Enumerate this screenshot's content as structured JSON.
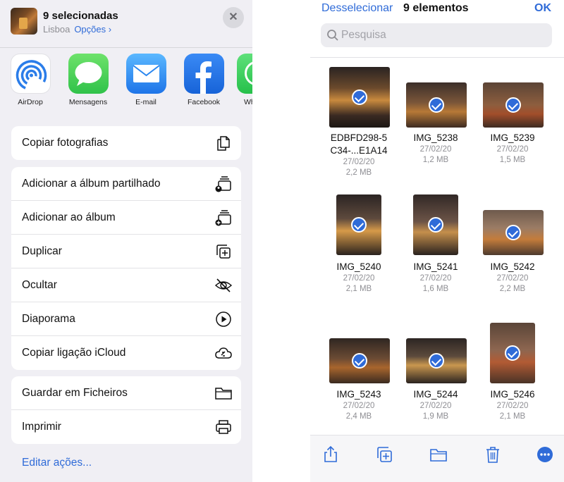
{
  "share_sheet": {
    "title": "9 selecionadas",
    "location": "Lisboa",
    "options_label": "Opções ›",
    "apps": [
      {
        "label": "AirDrop",
        "icon": "airdrop-icon"
      },
      {
        "label": "Mensagens",
        "icon": "messages-icon"
      },
      {
        "label": "E-mail",
        "icon": "mail-icon"
      },
      {
        "label": "Facebook",
        "icon": "facebook-icon"
      },
      {
        "label": "Wh",
        "icon": "whatsapp-icon"
      }
    ],
    "group1": [
      {
        "label": "Copiar fotografias",
        "icon": "copy-icon"
      }
    ],
    "group2": [
      {
        "label": "Adicionar a álbum partilhado",
        "icon": "shared-album-icon"
      },
      {
        "label": "Adicionar ao álbum",
        "icon": "add-album-icon"
      },
      {
        "label": "Duplicar",
        "icon": "duplicate-icon"
      },
      {
        "label": "Ocultar",
        "icon": "hide-icon"
      },
      {
        "label": "Diaporama",
        "icon": "play-icon"
      },
      {
        "label": "Copiar ligação iCloud",
        "icon": "icloud-link-icon"
      }
    ],
    "group3": [
      {
        "label": "Guardar em Ficheiros",
        "icon": "folder-icon"
      },
      {
        "label": "Imprimir",
        "icon": "printer-icon"
      }
    ],
    "edit_actions": "Editar ações..."
  },
  "files": {
    "deselect": "Desselecionar",
    "title": "9 elementos",
    "ok": "OK",
    "search_placeholder": "Pesquisa",
    "items": [
      {
        "name1": "EDBFD298-5",
        "name2": "C34-...E1A14",
        "date": "27/02/20",
        "size": "2,2 MB"
      },
      {
        "name1": "IMG_5238",
        "name2": "",
        "date": "27/02/20",
        "size": "1,2 MB"
      },
      {
        "name1": "IMG_5239",
        "name2": "",
        "date": "27/02/20",
        "size": "1,5 MB"
      },
      {
        "name1": "IMG_5240",
        "name2": "",
        "date": "27/02/20",
        "size": "2,1 MB"
      },
      {
        "name1": "IMG_5241",
        "name2": "",
        "date": "27/02/20",
        "size": "1,6 MB"
      },
      {
        "name1": "IMG_5242",
        "name2": "",
        "date": "27/02/20",
        "size": "2,2 MB"
      },
      {
        "name1": "IMG_5243",
        "name2": "",
        "date": "27/02/20",
        "size": "2,4 MB"
      },
      {
        "name1": "IMG_5244",
        "name2": "",
        "date": "27/02/20",
        "size": "1,9 MB"
      },
      {
        "name1": "IMG_5246",
        "name2": "",
        "date": "27/02/20",
        "size": "2,1 MB"
      }
    ],
    "toolbar_icons": [
      "share-icon",
      "duplicate-icon",
      "folder-icon",
      "trash-icon",
      "more-icon"
    ]
  },
  "colors": {
    "accent": "#2f6bd8",
    "sheet_background": "#f0eff4",
    "secondary_text": "#8e8e93"
  }
}
